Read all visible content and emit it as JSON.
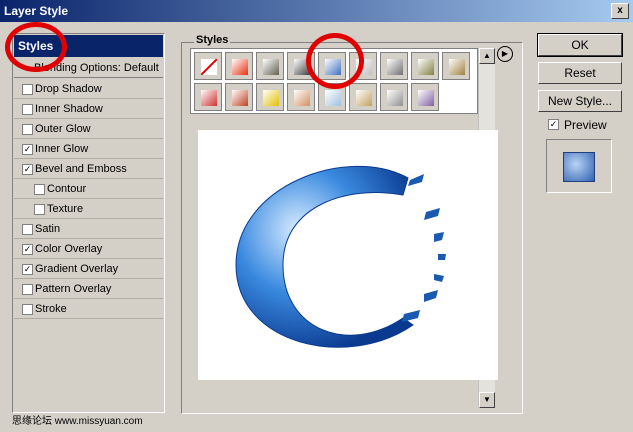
{
  "window": {
    "title": "Layer Style",
    "close_glyph": "x"
  },
  "left_panel": {
    "header": "Styles",
    "blending_options": "Blending Options: Default",
    "options": [
      {
        "label": "Drop Shadow",
        "checked": false,
        "indent": false
      },
      {
        "label": "Inner Shadow",
        "checked": false,
        "indent": false
      },
      {
        "label": "Outer Glow",
        "checked": false,
        "indent": false
      },
      {
        "label": "Inner Glow",
        "checked": true,
        "indent": false
      },
      {
        "label": "Bevel and Emboss",
        "checked": true,
        "indent": false
      },
      {
        "label": "Contour",
        "checked": false,
        "indent": true
      },
      {
        "label": "Texture",
        "checked": false,
        "indent": true
      },
      {
        "label": "Satin",
        "checked": false,
        "indent": false
      },
      {
        "label": "Color Overlay",
        "checked": true,
        "indent": false
      },
      {
        "label": "Gradient Overlay",
        "checked": true,
        "indent": false
      },
      {
        "label": "Pattern Overlay",
        "checked": false,
        "indent": false
      },
      {
        "label": "Stroke",
        "checked": false,
        "indent": false
      }
    ]
  },
  "styles_group": {
    "label": "Styles"
  },
  "swatch_colors": [
    "#ffffff",
    "#e83010",
    "#606050",
    "#404040",
    "#4070c0",
    "#c0c0c0",
    "#707070",
    "#808040",
    "#a08040",
    "#d03030",
    "#c04020",
    "#e0c000",
    "#d09060",
    "#a0c0e0",
    "#c0a060",
    "#909090",
    "#8060a0"
  ],
  "buttons": {
    "ok": "OK",
    "reset": "Reset",
    "new_style": "New Style...",
    "preview": "Preview"
  },
  "preview_checked": true,
  "watermark": "思缘论坛  www.missyuan.com"
}
